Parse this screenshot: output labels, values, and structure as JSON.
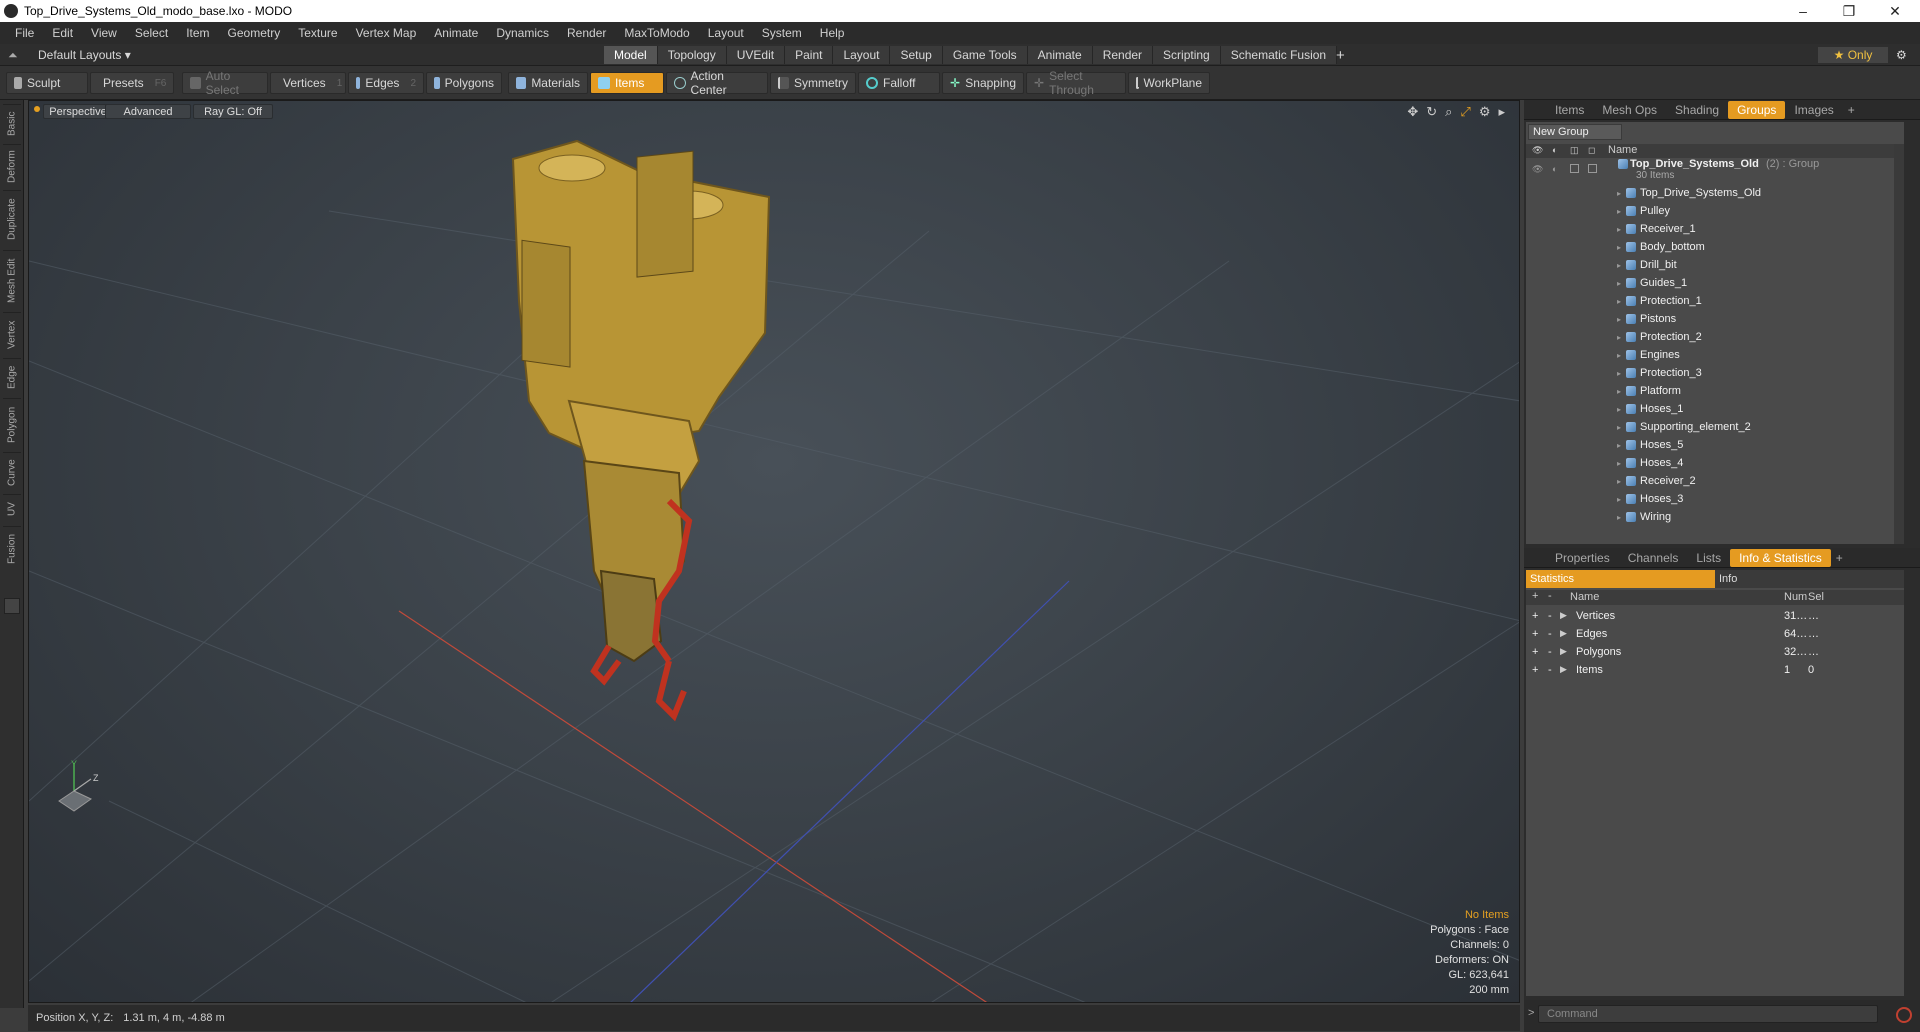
{
  "window": {
    "title": "Top_Drive_Systems_Old_modo_base.lxo - MODO",
    "minimize": "–",
    "maximize": "❐",
    "close": "✕"
  },
  "menu": [
    "File",
    "Edit",
    "View",
    "Select",
    "Item",
    "Geometry",
    "Texture",
    "Vertex Map",
    "Animate",
    "Dynamics",
    "Render",
    "MaxToModo",
    "Layout",
    "System",
    "Help"
  ],
  "layoutbar": {
    "layouts_label": "Default Layouts ▾",
    "tabs": [
      "Model",
      "Topology",
      "UVEdit",
      "Paint",
      "Layout",
      "Setup",
      "Game Tools",
      "Animate",
      "Render",
      "Scripting",
      "Schematic Fusion"
    ],
    "active_tab": "Model",
    "add_tab": "+",
    "only_label": "★ Only"
  },
  "toolbar": {
    "sculpt": "Sculpt",
    "presets": "Presets",
    "presets_key": "F6",
    "auto_select": "Auto Select",
    "vertices": "Vertices",
    "vertices_count": "1",
    "edges": "Edges",
    "edges_count": "2",
    "polygons": "Polygons",
    "materials": "Materials",
    "items": "Items",
    "action_center": "Action Center",
    "symmetry": "Symmetry",
    "falloff": "Falloff",
    "snapping": "Snapping",
    "select_through": "Select Through",
    "workplane": "WorkPlane"
  },
  "left_tabs": [
    "Basic",
    "Deform",
    "Duplicate",
    "Mesh Edit",
    "Vertex",
    "Edge",
    "Polygon",
    "Curve",
    "UV",
    "Fusion"
  ],
  "viewport": {
    "view": "Perspective",
    "shading": "Advanced",
    "raygl": "Ray GL: Off",
    "hud": [
      "No Items",
      "Polygons : Face",
      "Channels: 0",
      "Deformers: ON",
      "GL: 623,641",
      "200 mm"
    ],
    "axis_y": "Y",
    "axis_z": "Z"
  },
  "status": {
    "label": "Position X, Y, Z:",
    "value": "1.31 m, 4 m, -4.88 m"
  },
  "groups_panel": {
    "tabs": [
      "Items",
      "Mesh Ops",
      "Shading",
      "Groups",
      "Images"
    ],
    "active_tab": "Groups",
    "new_group": "New Group",
    "col_name": "Name",
    "root_name": "Top_Drive_Systems_Old",
    "root_suffix": "(2) : Group",
    "root_count": "30 Items",
    "items": [
      "Top_Drive_Systems_Old",
      "Pulley",
      "Receiver_1",
      "Body_bottom",
      "Drill_bit",
      "Guides_1",
      "Protection_1",
      "Pistons",
      "Protection_2",
      "Engines",
      "Protection_3",
      "Platform",
      "Hoses_1",
      "Supporting_element_2",
      "Hoses_5",
      "Hoses_4",
      "Receiver_2",
      "Hoses_3",
      "Wiring"
    ]
  },
  "stats_panel": {
    "tabs": [
      "Properties",
      "Channels",
      "Lists",
      "Info & Statistics"
    ],
    "active_tab": "Info & Statistics",
    "subtabs": [
      "Statistics",
      "Info"
    ],
    "col_name": "Name",
    "col_num": "Num",
    "col_sel": "Sel",
    "rows": [
      {
        "name": "Vertices",
        "num": "31…",
        "sel": "…"
      },
      {
        "name": "Edges",
        "num": "64…",
        "sel": "…"
      },
      {
        "name": "Polygons",
        "num": "32…",
        "sel": "…"
      },
      {
        "name": "Items",
        "num": "1",
        "sel": "0"
      }
    ]
  },
  "command": {
    "prompt": ">",
    "placeholder": "Command"
  },
  "colors": {
    "accent": "#e59b21",
    "model_yellow": "#c9a43a",
    "hook_red": "#c0321f"
  }
}
